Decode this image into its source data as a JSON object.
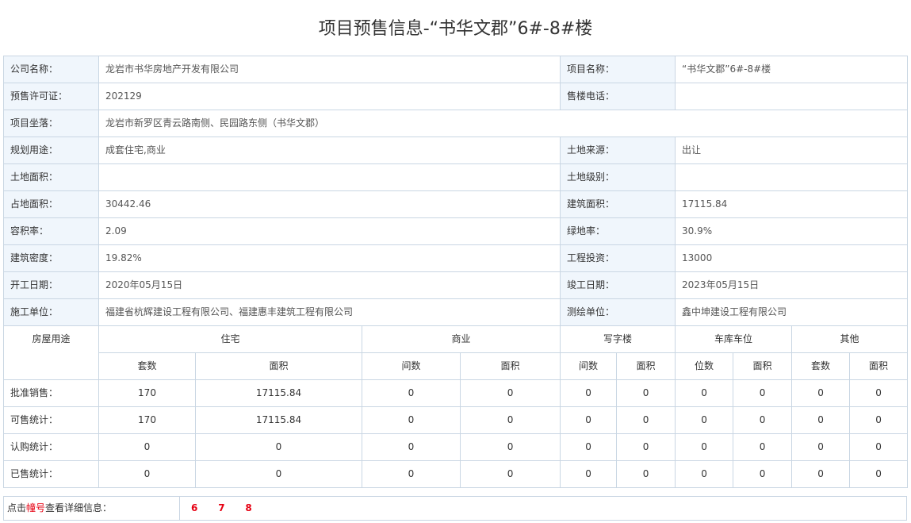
{
  "page": {
    "title": "项目预售信息-“书华文郡”6#-8#楼"
  },
  "info_rows": [
    {
      "l1": "公司名称：",
      "v1": "龙岩市书华房地产开发有限公司",
      "l2": "项目名称：",
      "v2": "“书华文郡”6#-8#楼"
    },
    {
      "l1": "预售许可证：",
      "v1": "202129",
      "l2": "售楼电话：",
      "v2": ""
    },
    {
      "l1": "项目坐落：",
      "v1": "龙岩市新罗区青云路南侧、民园路东侧（书华文郡）"
    },
    {
      "l1": "规划用途：",
      "v1": "成套住宅,商业",
      "l2": "土地来源：",
      "v2": "出让"
    },
    {
      "l1": "土地面积：",
      "v1": "",
      "l2": "土地级别：",
      "v2": ""
    },
    {
      "l1": "占地面积：",
      "v1": "30442.46",
      "l2": "建筑面积：",
      "v2": "17115.84"
    },
    {
      "l1": "容积率：",
      "v1": "2.09",
      "l2": "绿地率：",
      "v2": "30.9%"
    },
    {
      "l1": "建筑密度：",
      "v1": "19.82%",
      "l2": "工程投资：",
      "v2": "13000"
    },
    {
      "l1": "开工日期：",
      "v1": "2020年05月15日",
      "l2": "竣工日期：",
      "v2": "2023年05月15日"
    },
    {
      "l1": "施工单位：",
      "v1": "福建省杭辉建设工程有限公司、福建惠丰建筑工程有限公司",
      "l2": "测绘单位：",
      "v2": "鑫中坤建设工程有限公司"
    }
  ],
  "stats": {
    "usage_header": "房屋用途",
    "groups": [
      "住宅",
      "商业",
      "写字楼",
      "车库车位",
      "其他"
    ],
    "subheaders": [
      "套数",
      "面积",
      "间数",
      "面积",
      "间数",
      "面积",
      "位数",
      "面积",
      "套数",
      "面积"
    ],
    "rows": [
      {
        "label": "批准销售：",
        "values": [
          "170",
          "17115.84",
          "0",
          "0",
          "0",
          "0",
          "0",
          "0",
          "0",
          "0"
        ]
      },
      {
        "label": "可售统计：",
        "values": [
          "170",
          "17115.84",
          "0",
          "0",
          "0",
          "0",
          "0",
          "0",
          "0",
          "0"
        ]
      },
      {
        "label": "认购统计：",
        "values": [
          "0",
          "0",
          "0",
          "0",
          "0",
          "0",
          "0",
          "0",
          "0",
          "0"
        ]
      },
      {
        "label": "已售统计：",
        "values": [
          "0",
          "0",
          "0",
          "0",
          "0",
          "0",
          "0",
          "0",
          "0",
          "0"
        ]
      }
    ]
  },
  "footer": {
    "prefix": "点击",
    "highlight": "幢号",
    "suffix": "查看详细信息：",
    "buildings": [
      "6",
      "7",
      "8"
    ]
  }
}
